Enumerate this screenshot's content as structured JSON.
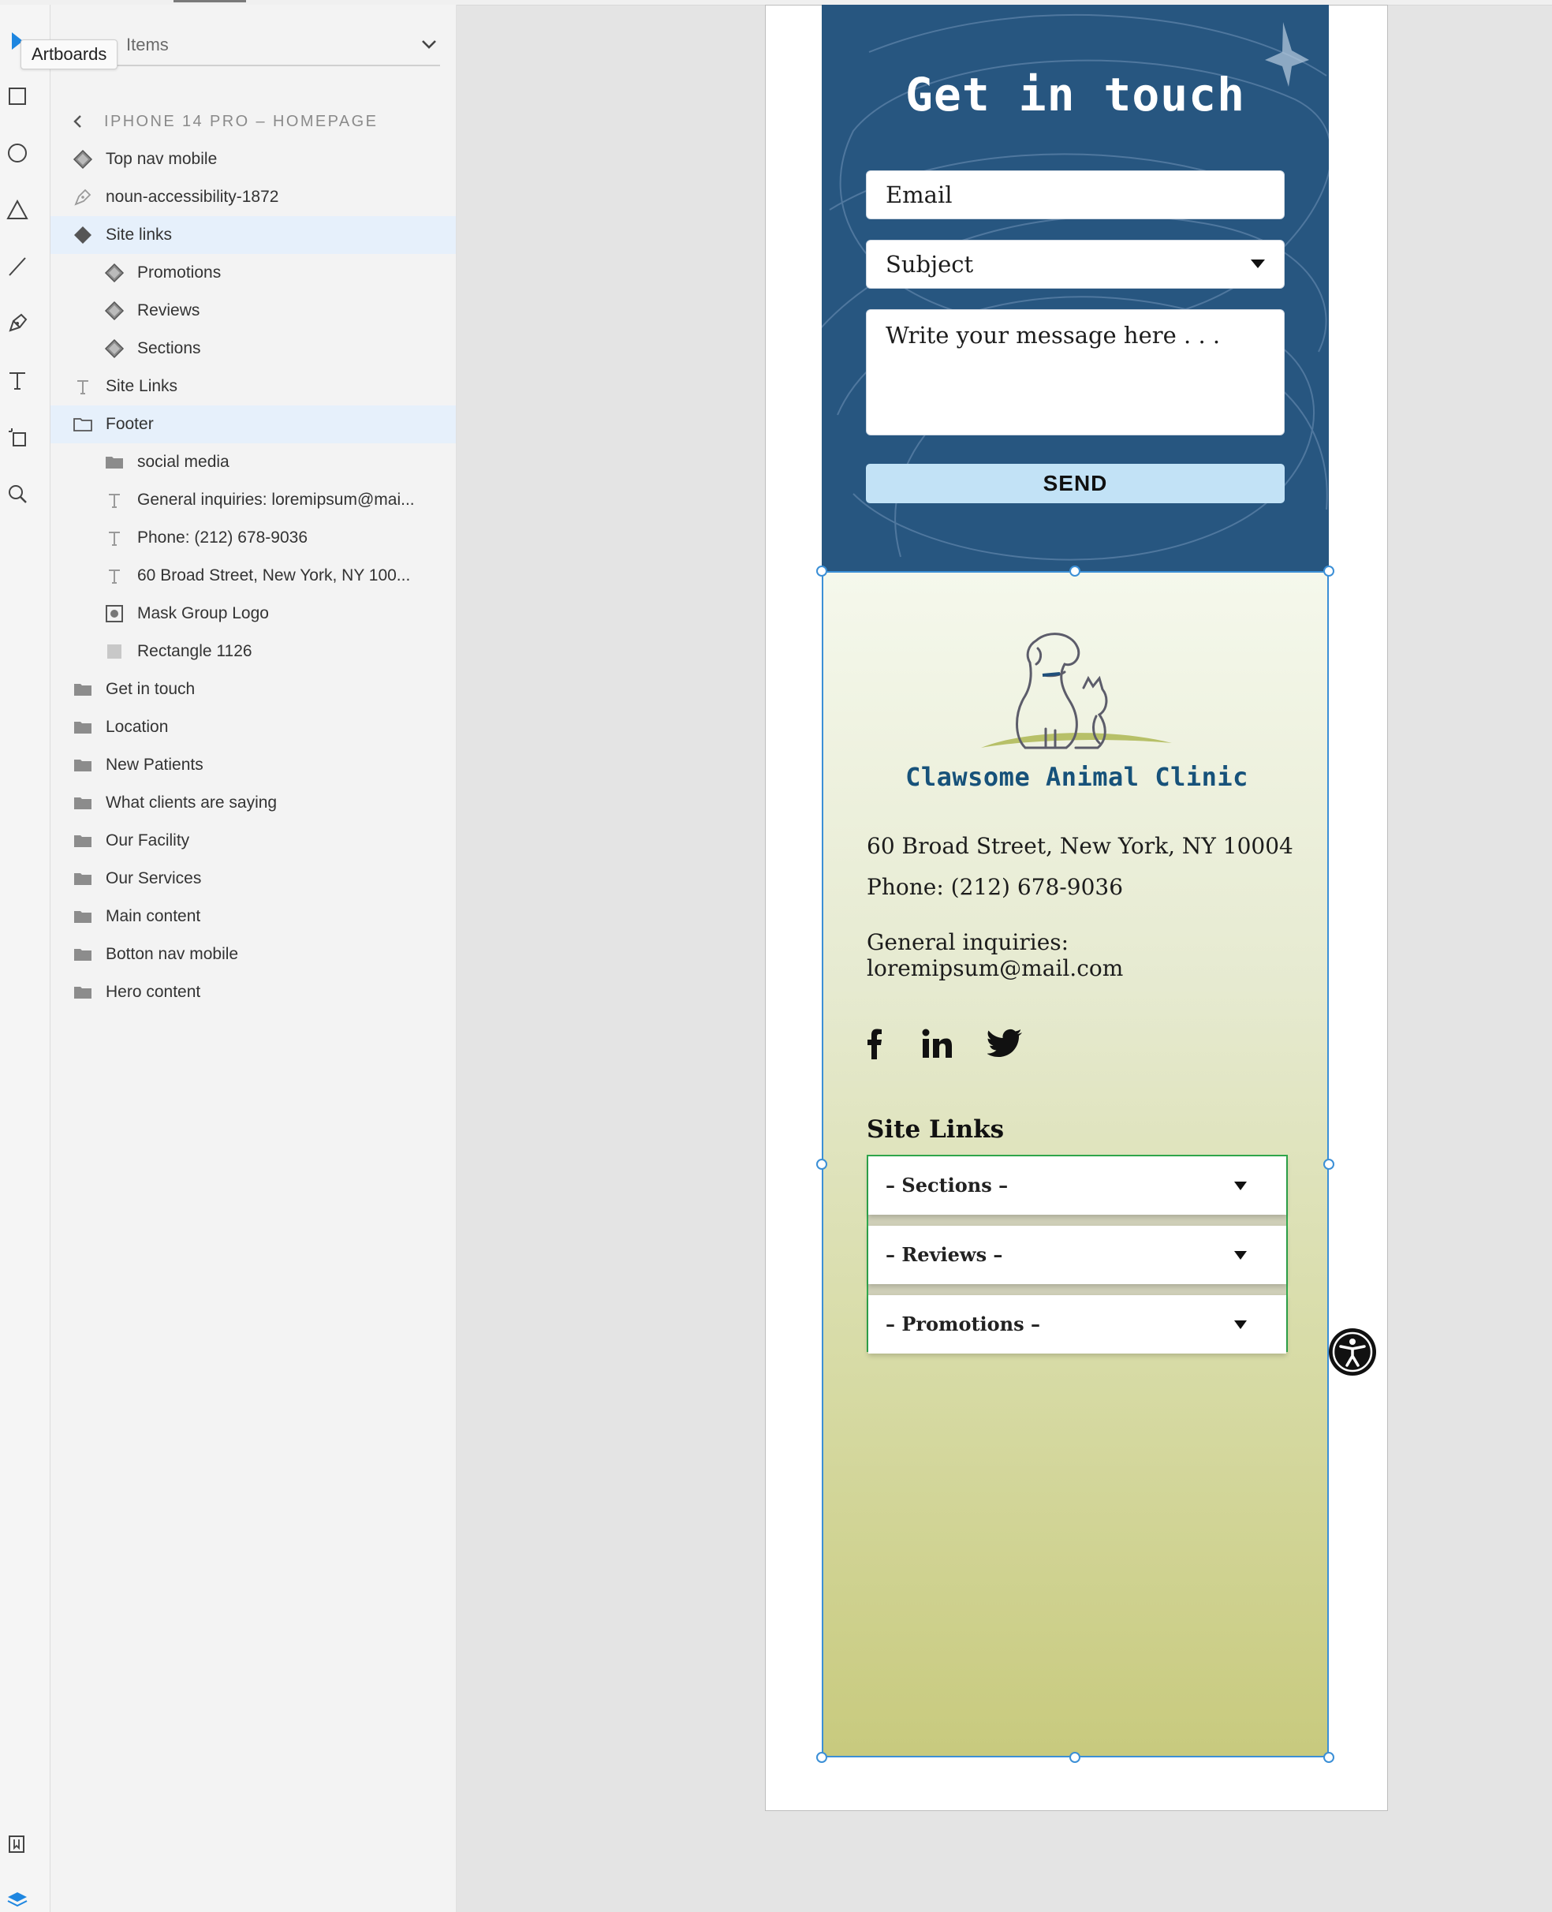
{
  "app": {
    "tooltip": "Artboards",
    "panel_title": "Items",
    "breadcrumb": "IPHONE 14 PRO – HOMEPAGE"
  },
  "tools": [
    "select-tool",
    "rectangle-tool",
    "ellipse-tool",
    "polygon-tool",
    "line-tool",
    "pen-tool",
    "text-tool",
    "artboard-tool",
    "zoom-tool"
  ],
  "layers": [
    {
      "label": "Top nav mobile",
      "icon": "component",
      "indent": 0,
      "selected": false
    },
    {
      "label": "noun-accessibility-1872",
      "icon": "pen-path",
      "indent": 0,
      "selected": false
    },
    {
      "label": "Site links",
      "icon": "component-main",
      "indent": 0,
      "selected": true
    },
    {
      "label": "Promotions",
      "icon": "component",
      "indent": 1,
      "selected": false
    },
    {
      "label": "Reviews",
      "icon": "component",
      "indent": 1,
      "selected": false
    },
    {
      "label": "Sections",
      "icon": "component",
      "indent": 1,
      "selected": false
    },
    {
      "label": "Site Links",
      "icon": "text",
      "indent": 0,
      "selected": false
    },
    {
      "label": "Footer",
      "icon": "folder-open",
      "indent": 0,
      "selected": true
    },
    {
      "label": "social media",
      "icon": "folder",
      "indent": 1,
      "selected": false
    },
    {
      "label": "General inquiries: loremipsum@mai...",
      "icon": "text",
      "indent": 1,
      "selected": false
    },
    {
      "label": "Phone: (212) 678-9036",
      "icon": "text",
      "indent": 1,
      "selected": false
    },
    {
      "label": "60 Broad Street, New York, NY 100...",
      "icon": "text",
      "indent": 1,
      "selected": false
    },
    {
      "label": "Mask Group Logo",
      "icon": "mask",
      "indent": 1,
      "selected": false
    },
    {
      "label": "Rectangle 1126",
      "icon": "rectangle",
      "indent": 1,
      "selected": false
    },
    {
      "label": "Get in touch",
      "icon": "folder",
      "indent": 0,
      "selected": false
    },
    {
      "label": "Location",
      "icon": "folder",
      "indent": 0,
      "selected": false
    },
    {
      "label": "New Patients",
      "icon": "folder",
      "indent": 0,
      "selected": false
    },
    {
      "label": "What clients are saying",
      "icon": "folder",
      "indent": 0,
      "selected": false
    },
    {
      "label": "Our Facility",
      "icon": "folder",
      "indent": 0,
      "selected": false
    },
    {
      "label": "Our Services",
      "icon": "folder",
      "indent": 0,
      "selected": false
    },
    {
      "label": "Main content",
      "icon": "folder",
      "indent": 0,
      "selected": false
    },
    {
      "label": "Botton nav mobile",
      "icon": "folder",
      "indent": 0,
      "selected": false
    },
    {
      "label": "Hero content",
      "icon": "folder",
      "indent": 0,
      "selected": false
    }
  ],
  "contact": {
    "title": "Get in touch",
    "email_placeholder": "Email",
    "subject_placeholder": "Subject",
    "message_placeholder": "Write your message here . . .",
    "send_label": "SEND"
  },
  "footer": {
    "clinic_name": "Clawsome Animal Clinic",
    "address": "60 Broad Street, New York, NY 10004",
    "phone": "Phone: (212) 678-9036",
    "email": "General inquiries: loremipsum@mail.com",
    "social": [
      "facebook-icon",
      "linkedin-icon",
      "twitter-icon"
    ],
    "site_links_title": "Site Links",
    "dropdowns": [
      "– Sections –",
      "– Reviews –",
      "– Promotions –"
    ]
  },
  "colors": {
    "contact_bg": "#275680",
    "send_bg": "#c2e2f6",
    "clinic_name": "#17527a",
    "selection": "#3b8fd6",
    "dropdown_group_border": "#2fa84c",
    "layer_selected_bg": "#e6f0fb"
  }
}
